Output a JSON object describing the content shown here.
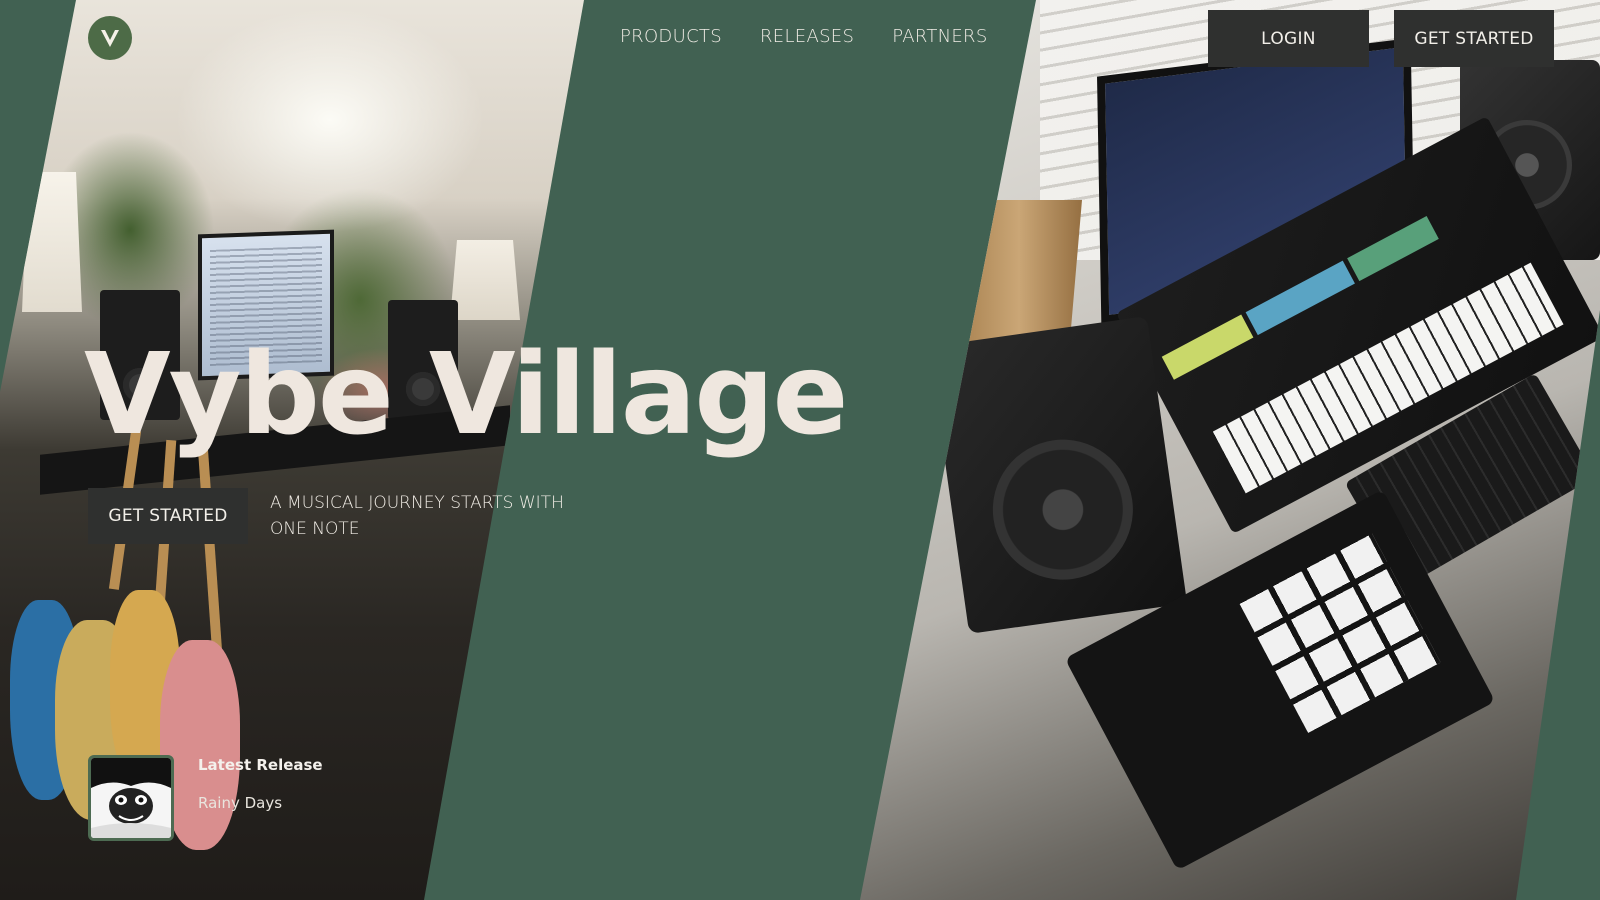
{
  "brand": {
    "name": "Vybe Village",
    "logo_letter": "V",
    "logo_icon": "v-monogram-icon",
    "colors": {
      "background_green": "#416152",
      "logo_green": "#4d6b47",
      "button_dark": "#2f302f",
      "text_light": "#efe7df"
    }
  },
  "nav": {
    "items": [
      {
        "label": "PRODUCTS"
      },
      {
        "label": "RELEASES"
      },
      {
        "label": "PARTNERS"
      }
    ]
  },
  "header": {
    "login_label": "LOGIN",
    "cta_label": "GET STARTED"
  },
  "hero": {
    "title": "Vybe Village",
    "cta_label": "GET STARTED",
    "tagline": "A MUSICAL JOURNEY STARTS WITH ONE NOTE"
  },
  "latest_release": {
    "label": "Latest Release",
    "title": "Rainy Days"
  },
  "images": {
    "left": "studio-photo-guitars-plants",
    "right": "studio-photo-synth-laptop"
  }
}
